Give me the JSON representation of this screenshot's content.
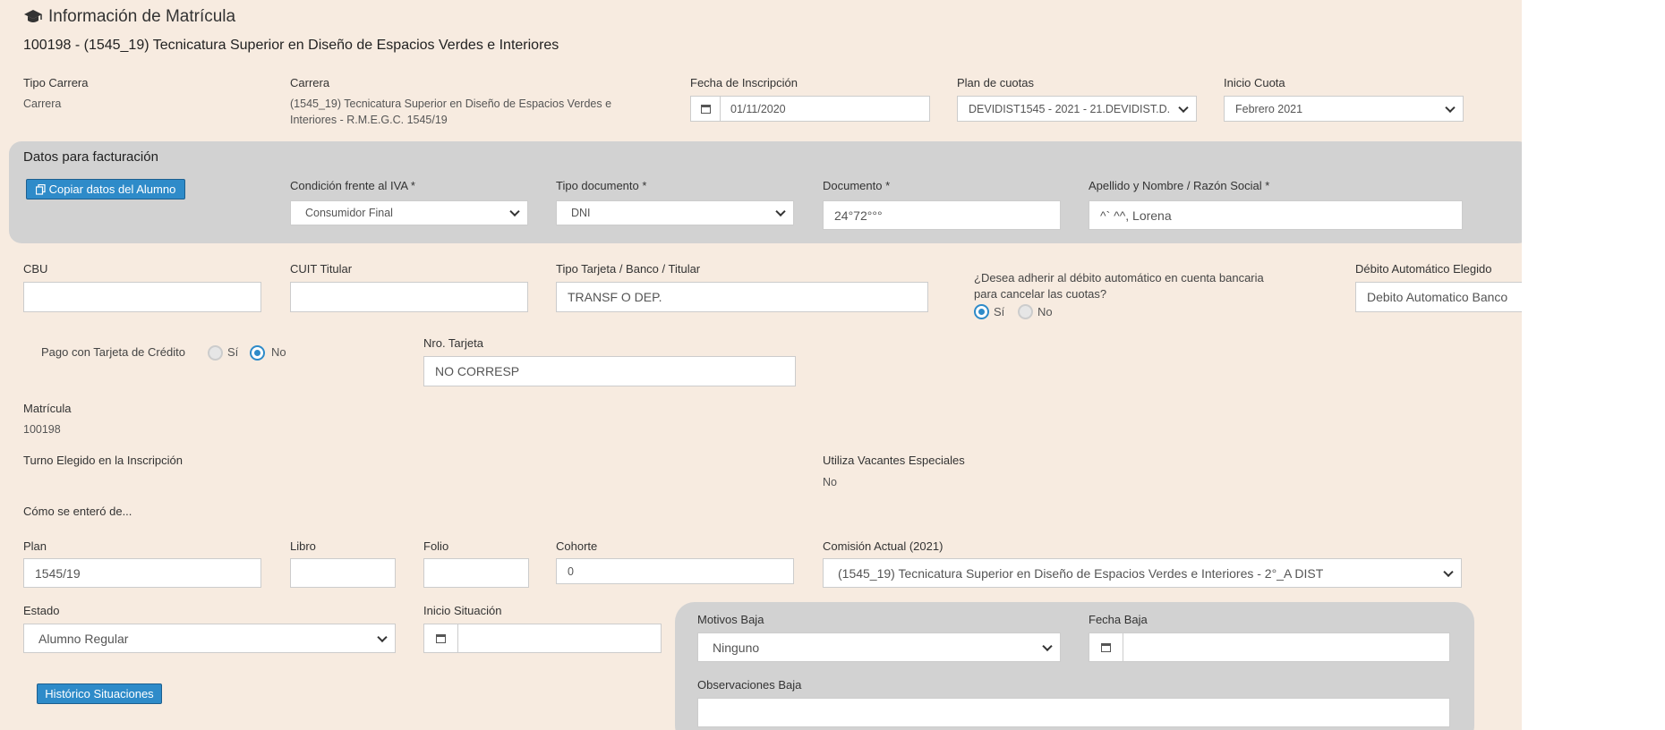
{
  "header": {
    "title": "Información de Matrícula",
    "subtitle": "100198 - (1545_19) Tecnicatura Superior en Diseño de Espacios Verdes e Interiores"
  },
  "carrera": {
    "tipo_label": "Tipo Carrera",
    "tipo_value": "Carrera",
    "carrera_label": "Carrera",
    "carrera_value_1": "(1545_19) Tecnicatura Superior en Diseño de Espacios Verdes e",
    "carrera_value_2": "Interiores - R.M.E.G.C. 1545/19",
    "fecha_label": "Fecha de Inscripción",
    "fecha_value": "01/11/2020",
    "plan_cuotas_label": "Plan de cuotas",
    "plan_cuotas_value": "DEVIDIST1545 - 2021 - 21.DEVIDIST.D.",
    "inicio_cuota_label": "Inicio Cuota",
    "inicio_cuota_value": "Febrero 2021"
  },
  "facturacion": {
    "title": "Datos para facturación",
    "copy_button": "Copiar datos del Alumno",
    "iva_label": "Condición frente al IVA *",
    "iva_value": "Consumidor Final",
    "tipo_doc_label": "Tipo documento *",
    "tipo_doc_value": "DNI",
    "doc_label": "Documento *",
    "doc_value": "24°72°°°",
    "nombre_label": "Apellido y Nombre / Razón Social *",
    "nombre_value": "^` ^^, Lorena"
  },
  "banco": {
    "cbu_label": "CBU",
    "cbu_value": "",
    "cuit_label": "CUIT Titular",
    "cuit_value": "",
    "tarjeta_label": "Tipo Tarjeta / Banco / Titular",
    "tarjeta_value": "TRANSF O DEP.",
    "debito_q1": "¿Desea adherir al débito automático en cuenta bancaria",
    "debito_q2": "para cancelar las cuotas?",
    "debito_si": "Sí",
    "debito_no": "No",
    "debito_elegido_label": "Débito Automático Elegido",
    "debito_elegido_value": "Debito Automatico Banco"
  },
  "pago": {
    "label": "Pago con Tarjeta de Crédito",
    "si": "Sí",
    "no": "No",
    "nro_label": "Nro. Tarjeta",
    "nro_value": "NO CORRESP"
  },
  "matricula": {
    "label": "Matrícula",
    "value": "100198",
    "turno_label": "Turno Elegido en la Inscripción",
    "vacantes_label": "Utiliza Vacantes Especiales",
    "vacantes_value": "No",
    "como_label": "Cómo se enteró de..."
  },
  "plan": {
    "plan_label": "Plan",
    "plan_value": "1545/19",
    "libro_label": "Libro",
    "libro_value": "",
    "folio_label": "Folio",
    "folio_value": "",
    "cohorte_label": "Cohorte",
    "cohorte_value": "0",
    "comision_label": "Comisión Actual (2021)",
    "comision_value": "(1545_19) Tecnicatura Superior en Diseño de Espacios Verdes e Interiores - 2°_A DIST"
  },
  "estado": {
    "estado_label": "Estado",
    "estado_value": "Alumno Regular",
    "inicio_label": "Inicio Situación",
    "inicio_value": "",
    "historico_button": "Histórico Situaciones"
  },
  "baja": {
    "motivos_label": "Motivos Baja",
    "motivos_value": "Ninguno",
    "fecha_label": "Fecha Baja",
    "fecha_value": "",
    "obs_label": "Observaciones Baja",
    "obs_value": ""
  },
  "colors": {
    "panel": "#f7ebe0",
    "grey_section": "#d2d2d2",
    "accent": "#2e8bc9"
  }
}
